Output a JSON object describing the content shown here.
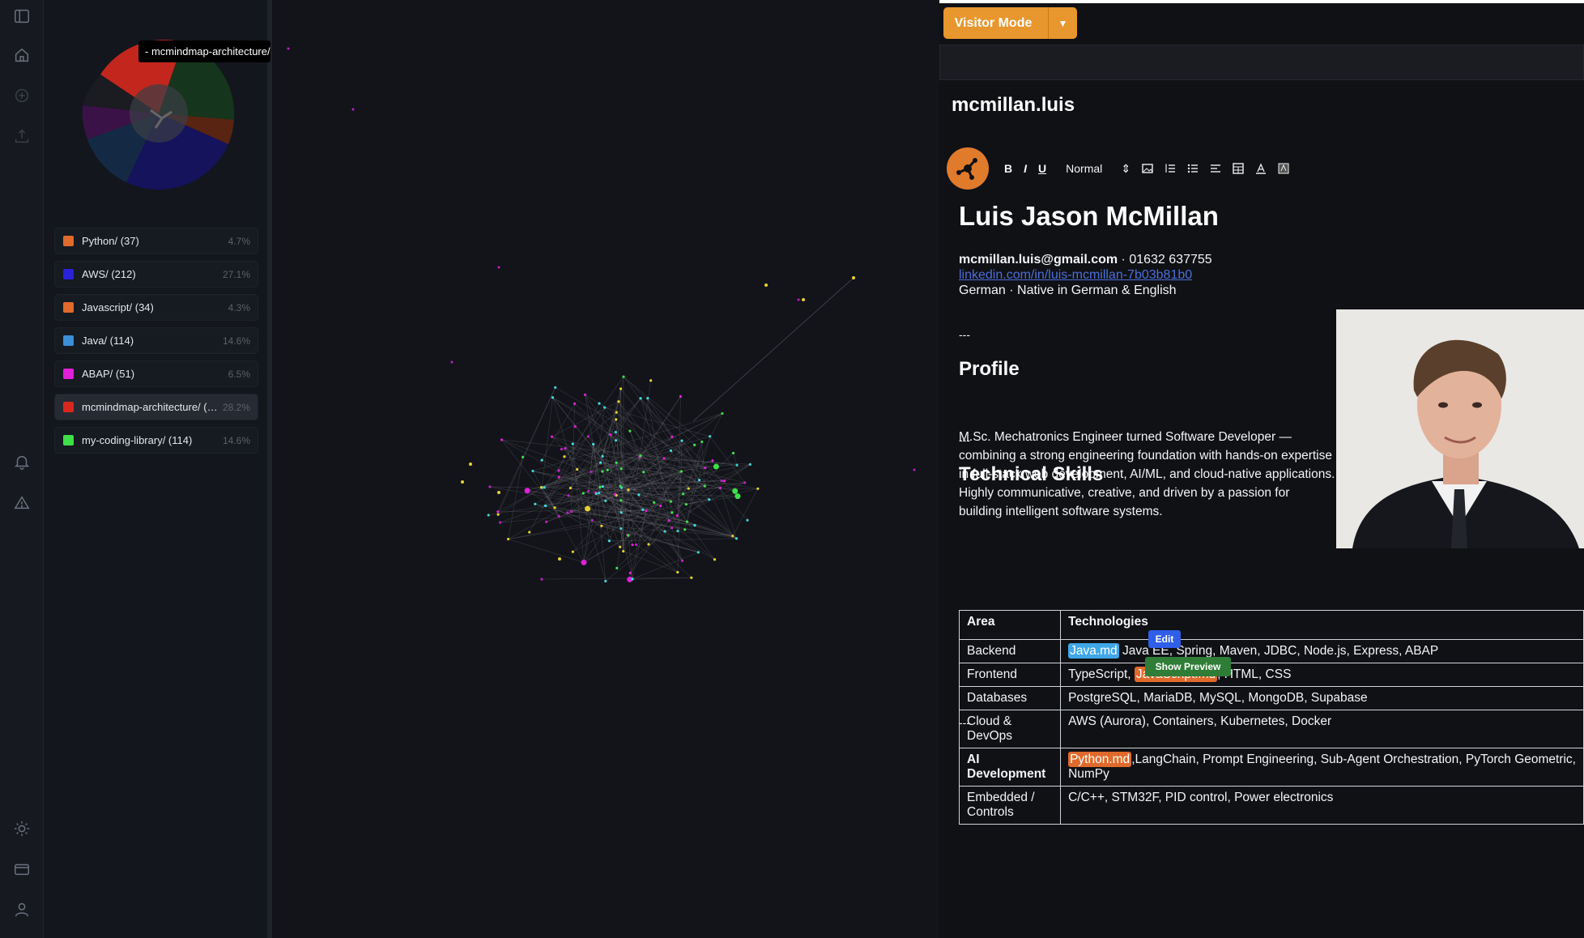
{
  "rail": {
    "icons": [
      "sidebar-toggle-icon",
      "home-icon",
      "add-circle-icon",
      "upload-icon",
      "bell-icon",
      "warning-icon",
      "sun-icon",
      "card-icon",
      "user-icon"
    ]
  },
  "panel": {
    "tooltip": "- mcmindmap-architecture/",
    "folders": [
      {
        "name": "Python/ (37)",
        "pct": "4.7%",
        "color": "#e06a2b"
      },
      {
        "name": "AWS/ (212)",
        "pct": "27.1%",
        "color": "#2a22d8"
      },
      {
        "name": "Javascript/ (34)",
        "pct": "4.3%",
        "color": "#e06a2b"
      },
      {
        "name": "Java/ (114)",
        "pct": "14.6%",
        "color": "#3a8fd8"
      },
      {
        "name": "ABAP/ (51)",
        "pct": "6.5%",
        "color": "#e020d8"
      },
      {
        "name": "mcmindmap-architecture/ (221)",
        "pct": "28.2%",
        "color": "#d8281e"
      },
      {
        "name": "my-coding-library/ (114)",
        "pct": "14.6%",
        "color": "#3ee048"
      }
    ]
  },
  "editor": {
    "visitor_mode": "Visitor Mode",
    "note_title": "mcmillan.luis",
    "toolbar": {
      "bold": "B",
      "italic": "I",
      "underline": "U",
      "style": "Normal"
    },
    "doc": {
      "name": "Luis Jason McMillan",
      "email": "mcmillan.luis@gmail.com",
      "phone": " · 01632 637755",
      "linkedin": "linkedin.com/in/luis-mcmillan-7b03b81b0",
      "languages": "German · Native in German & English",
      "separator": "---",
      "profile_heading": "Profile",
      "profile_text": "M.Sc. Mechatronics Engineer turned Software Developer — combining a strong engineering foundation with hands-on expertise in full-stack web development, AI/ML, and cloud-native applications. Highly communicative, creative, and driven by a passion for building intelligent software systems.",
      "skills_heading": "Technical Skills",
      "table": {
        "headers": [
          "Area",
          "Technologies"
        ],
        "rows": [
          {
            "area": "Backend",
            "ref": "Java.md",
            "ref_style": "blue",
            "tech_before": "",
            "tech_after": " Java EE, Spring, Maven, JDBC, Node.js, Express, ABAP"
          },
          {
            "area": "Frontend",
            "ref": "JavaScript.md",
            "ref_style": "orange",
            "tech_before": "TypeScript, ",
            "tech_after": ", HTML, CSS"
          },
          {
            "area": "Databases",
            "ref": "",
            "tech_before": "PostgreSQL, MariaDB, MySQL, MongoDB, Supabase",
            "tech_after": ""
          },
          {
            "area": "Cloud & DevOps",
            "ref": "",
            "tech_before": "AWS (Aurora), Containers, Kubernetes, Docker",
            "tech_after": ""
          },
          {
            "area": "AI Development",
            "ref": "Python.md",
            "ref_style": "orange",
            "tech_before": "",
            "tech_after": ",LangChain, Prompt Engineering, Sub-Agent Orchestration, PyTorch Geometric,",
            "tech_line2": "NumPy"
          },
          {
            "area": "Embedded / Controls",
            "ref": "",
            "tech_before": "C/C++, STM32F, PID control, Power electronics",
            "tech_after": ""
          }
        ]
      },
      "popups": {
        "edit": "Edit",
        "show_preview": "Show Preview"
      }
    }
  }
}
